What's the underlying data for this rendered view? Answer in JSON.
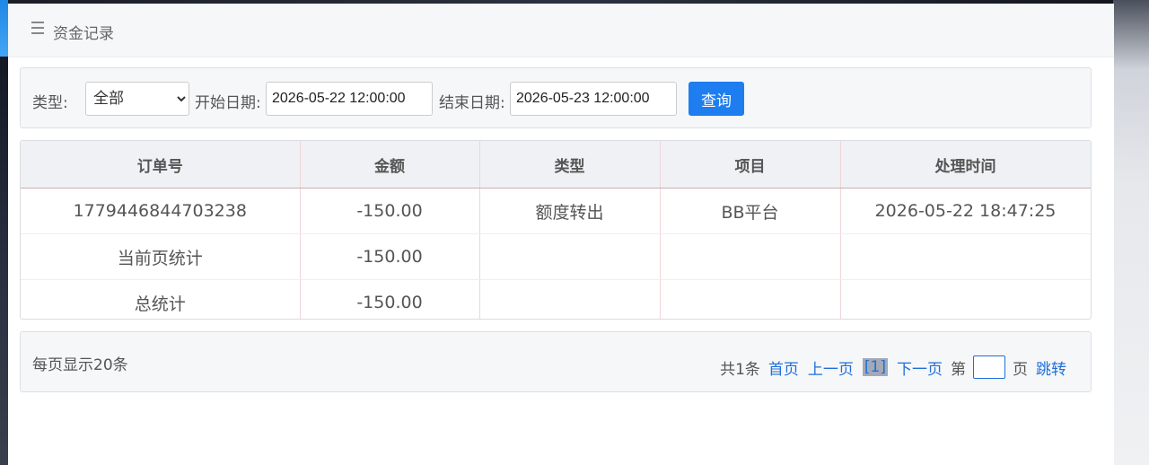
{
  "header": {
    "title": "资金记录"
  },
  "filter": {
    "type_label": "类型:",
    "type_selected": "全部",
    "start_label": "开始日期:",
    "start_value": "2026-05-22 12:00:00",
    "end_label": "结束日期:",
    "end_value": "2026-05-23 12:00:00",
    "query_label": "查询"
  },
  "table": {
    "columns": [
      "订单号",
      "金额",
      "类型",
      "项目",
      "处理时间"
    ],
    "rows": [
      [
        "1779446844703238",
        "-150.00",
        "额度转出",
        "BB平台",
        "2026-05-22 18:47:25"
      ],
      [
        "当前页统计",
        "-150.00",
        "",
        "",
        ""
      ],
      [
        "总统计",
        "-150.00",
        "",
        "",
        ""
      ]
    ]
  },
  "pager": {
    "per_page": "每页显示20条",
    "total": "共1条",
    "first": "首页",
    "prev": "上一页",
    "current": "[1]",
    "next": "下一页",
    "page_prefix": "第",
    "page_suffix": "页",
    "jump": "跳转"
  },
  "colors": {
    "accent": "#1e7ef0",
    "link": "#1e6fd9"
  }
}
